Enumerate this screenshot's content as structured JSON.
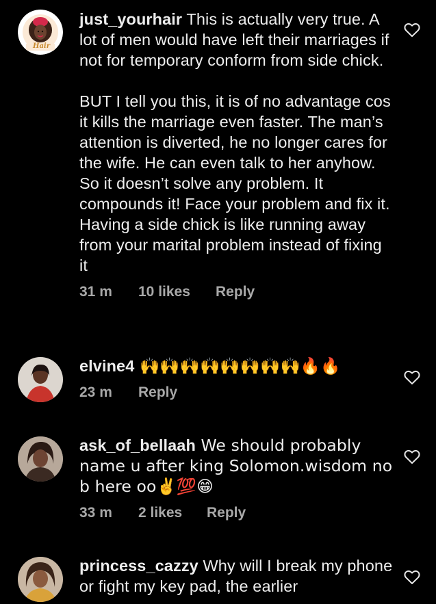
{
  "comments": [
    {
      "username": "just_yourhair",
      "text": " This is actually very true. A lot of men would have left their marriages if not for temporary conform from side chick.\n\nBUT I tell you this, it is of no advantage cos it kills the marriage even faster. The man’s attention is diverted, he no longer cares for the wife. He can even talk to her anyhow. So it doesn’t solve any problem. It compounds it! Face your problem and fix it. Having a side chick is like running away from your marital problem instead of fixing it",
      "time": "31 m",
      "likes": "10 likes",
      "reply": "Reply",
      "avatar_caption": "Hair"
    },
    {
      "username": "elvine4",
      "text": " 🙌🙌🙌🙌🙌🙌🙌🙌🔥🔥",
      "time": "23 m",
      "likes": "",
      "reply": "Reply"
    },
    {
      "username": "ask_of_bellaah",
      "text": " We should probably name u after king Solomon.wisdom no b here oo✌️💯😁",
      "time": "33 m",
      "likes": "2 likes",
      "reply": "Reply"
    },
    {
      "username": "princess_cazzy",
      "text": " Why will I break my phone or fight my key pad, the earlier",
      "time": "",
      "likes": "",
      "reply": ""
    }
  ],
  "icons": {
    "like": "heart-outline-icon"
  },
  "colors": {
    "background": "#000000",
    "text": "#ededed",
    "meta": "#a8a8a8"
  }
}
